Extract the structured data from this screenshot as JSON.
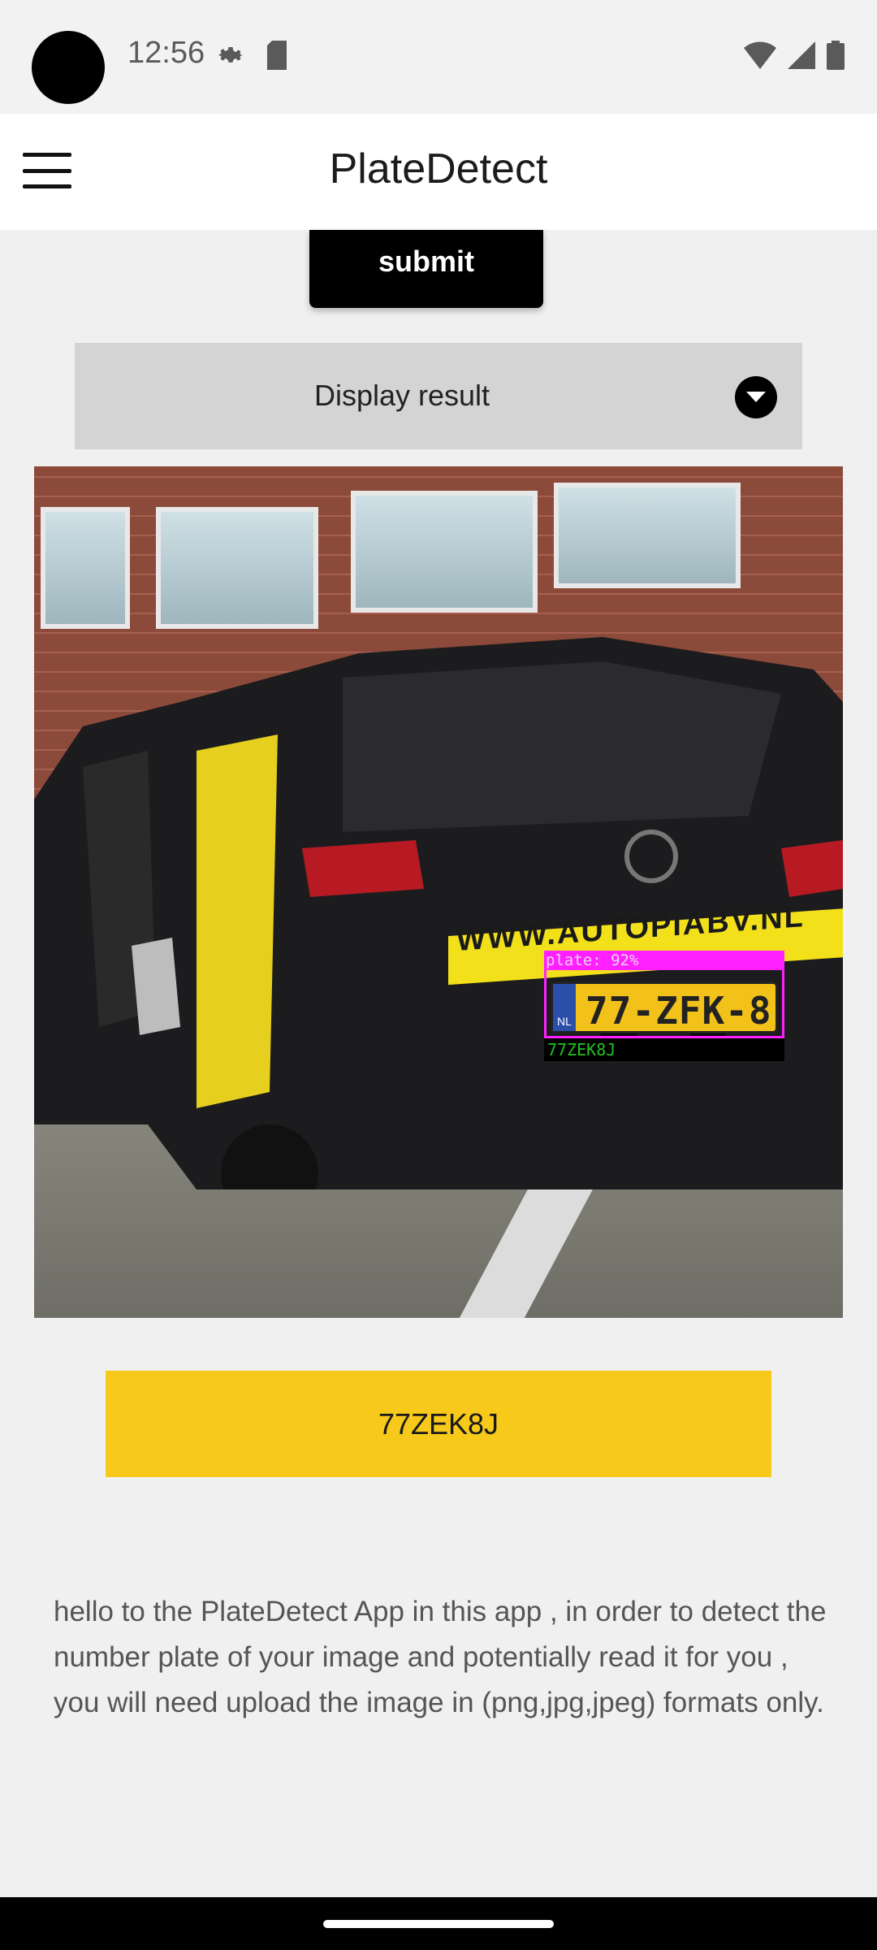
{
  "status_bar": {
    "time": "12:56",
    "icons": [
      "settings-icon",
      "sd-card-icon",
      "wifi-icon",
      "cell-signal-icon",
      "battery-icon"
    ]
  },
  "app_bar": {
    "title": "PlateDetect",
    "menu_icon": "hamburger-menu-icon"
  },
  "form": {
    "submit_label": "submit",
    "dropdown_label": "Display result",
    "dropdown_icon": "chevron-down-circle-icon"
  },
  "result": {
    "detection_label": "plate: 92%",
    "ocr_label": "77ZEK8J",
    "photo_banner_text": "WWW.AUTOPIABV.NL",
    "photo_plate_text": "77-ZFK-8",
    "photo_plate_country": "NL",
    "recognized_plate": "77ZEK8J",
    "box_color": "#ff20ff",
    "ocr_text_color": "#23c023"
  },
  "description": "hello to the PlateDetect App in this app , in order to detect the number plate of your image and potentially read it for you , you will need upload the image in (png,jpg,jpeg) formats only.",
  "colors": {
    "accent_yellow": "#f6c91a",
    "dropdown_bg": "#d4d4d4",
    "page_bg": "#f0f0f0"
  }
}
